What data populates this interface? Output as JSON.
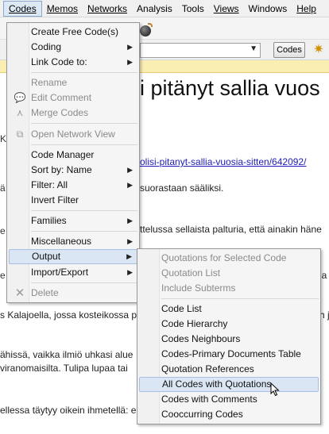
{
  "menubar": [
    {
      "label": "Codes",
      "underline_index": 0,
      "active": true
    },
    {
      "label": "Memos",
      "underline_index": 0
    },
    {
      "label": "Networks",
      "underline_index": 0
    },
    {
      "label": "Analysis"
    },
    {
      "label": "Tools"
    },
    {
      "label": "Views",
      "underline_index": 0
    },
    {
      "label": "Windows"
    },
    {
      "label": "Help",
      "underline_index": 0
    }
  ],
  "toolbar": {
    "codes_button": "Codes"
  },
  "document": {
    "heading": "i pitänyt sallia vuos",
    "sidebar_char": "K",
    "link": "olisi-pitanyt-sallia-vuosia-sitten/642092/",
    "lines": [
      "suorastaan sääliksi.",
      "ttelussa sellaista palturia, että ainakin häne",
      "s Kalajoella, jossa kosteikossa p",
      "ähissä, vaikka ilmiö uhkasi alue",
      "viranomaisilta. Tulipa lupaa tai",
      "ellessa täytyy oikein ihmetellä: e"
    ],
    "left_chars": [
      "ä",
      "e",
      "e"
    ],
    "right_chars": [
      "ja",
      "h j"
    ]
  },
  "codes_menu": {
    "items": [
      {
        "label": "Create Free Code(s)",
        "disabled": false,
        "submenu": false
      },
      {
        "label": "Coding",
        "disabled": false,
        "submenu": true
      },
      {
        "label": "Link Code to:",
        "disabled": false,
        "submenu": true
      },
      {
        "label": "Rename",
        "disabled": true,
        "submenu": false
      },
      {
        "label": "Edit Comment",
        "disabled": true,
        "submenu": false,
        "icon": "comment-icon"
      },
      {
        "label": "Merge Codes",
        "disabled": true,
        "submenu": false,
        "icon": "merge-icon"
      },
      {
        "label": "Open Network View",
        "disabled": true,
        "submenu": false,
        "icon": "network-icon"
      },
      {
        "label": "Code Manager",
        "disabled": false,
        "submenu": false
      },
      {
        "label": "Sort by: Name",
        "disabled": false,
        "submenu": true
      },
      {
        "label": "Filter: All",
        "disabled": false,
        "submenu": true
      },
      {
        "label": "Invert Filter",
        "disabled": false,
        "submenu": false
      },
      {
        "label": "Families",
        "disabled": false,
        "submenu": true
      },
      {
        "label": "Miscellaneous",
        "disabled": false,
        "submenu": true
      },
      {
        "label": "Output",
        "disabled": false,
        "submenu": true,
        "highlight": true
      },
      {
        "label": "Import/Export",
        "disabled": false,
        "submenu": true
      },
      {
        "label": "Delete",
        "disabled": true,
        "submenu": false,
        "icon": "delete-icon"
      }
    ]
  },
  "output_menu": {
    "items": [
      {
        "label": "Quotations for Selected Code",
        "disabled": true
      },
      {
        "label": "Quotation List",
        "disabled": true
      },
      {
        "label": "Include Subterms",
        "disabled": true
      },
      {
        "label": "Code List",
        "disabled": false
      },
      {
        "label": "Code Hierarchy",
        "disabled": false
      },
      {
        "label": "Codes Neighbours",
        "disabled": false
      },
      {
        "label": "Codes-Primary Documents Table",
        "disabled": false
      },
      {
        "label": "Quotation References",
        "disabled": false
      },
      {
        "label": "All Codes with Quotations",
        "disabled": false,
        "highlight": true
      },
      {
        "label": "Codes with Comments",
        "disabled": false
      },
      {
        "label": "Cooccurring Codes",
        "disabled": false
      }
    ]
  }
}
